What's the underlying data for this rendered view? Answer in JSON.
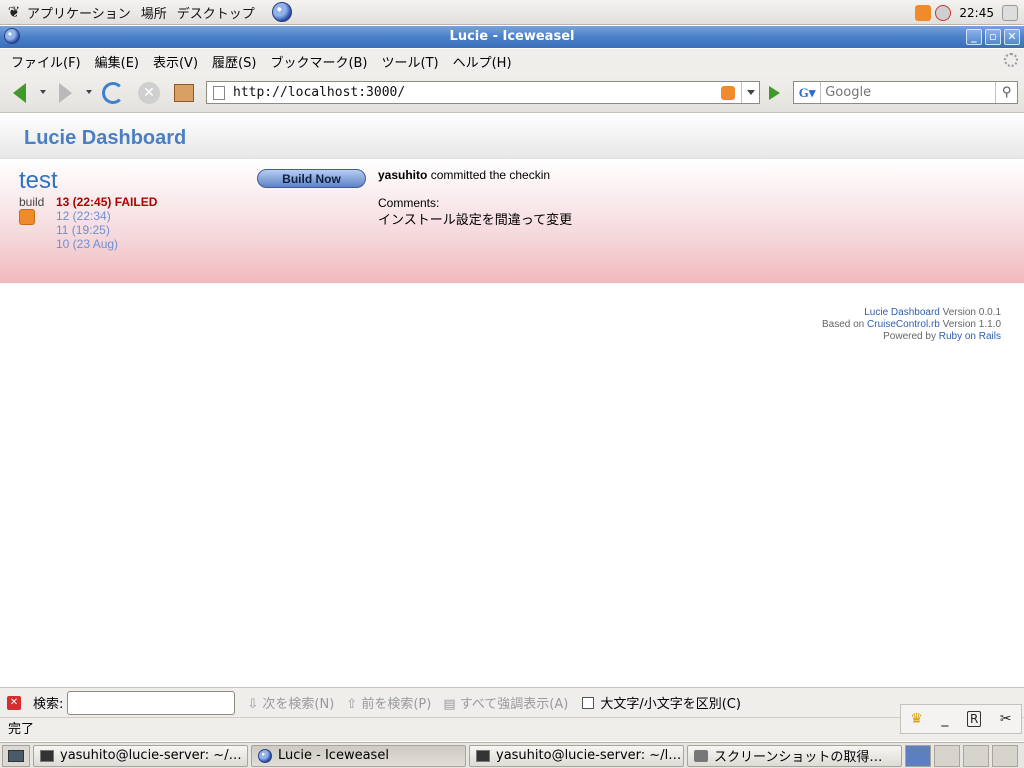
{
  "top_panel": {
    "menus": [
      "アプリケーション",
      "場所",
      "デスクトップ"
    ],
    "clock": "22:45"
  },
  "window": {
    "title": "Lucie - Iceweasel",
    "menu": [
      "ファイル(F)",
      "編集(E)",
      "表示(V)",
      "履歴(S)",
      "ブックマーク(B)",
      "ツール(T)",
      "ヘルプ(H)"
    ]
  },
  "toolbar": {
    "url": "http://localhost:3000/",
    "search_placeholder": "Google"
  },
  "dashboard": {
    "title": "Lucie Dashboard",
    "project": {
      "name": "test",
      "build_label": "build",
      "builds": [
        "13 (22:45) FAILED",
        "12 (22:34)",
        "11 (19:25)",
        "10 (23 Aug)"
      ],
      "build_now": "Build Now",
      "commit_author": "yasuhito",
      "commit_text": "committed the checkin",
      "comments_label": "Comments:",
      "comments_text": "インストール設定を間違って変更"
    },
    "footer": {
      "line1_link": "Lucie Dashboard",
      "line1_text": "Version 0.0.1",
      "line2_prefix": "Based on",
      "line2_link": "CruiseControl.rb",
      "line2_text": "Version 1.1.0",
      "line3_prefix": "Powered by",
      "line3_link": "Ruby on Rails"
    }
  },
  "findbar": {
    "label": "検索:",
    "next": "次を検索(N)",
    "prev": "前を検索(P)",
    "highlight": "すべて強調表示(A)",
    "case": "大文字/小文字を区別(C)"
  },
  "status": "完了",
  "taskbar": [
    "yasuhito@lucie-server: ~/…",
    "Lucie - Iceweasel",
    "yasuhito@lucie-server: ~/l…",
    "スクリーンショットの取得…"
  ]
}
